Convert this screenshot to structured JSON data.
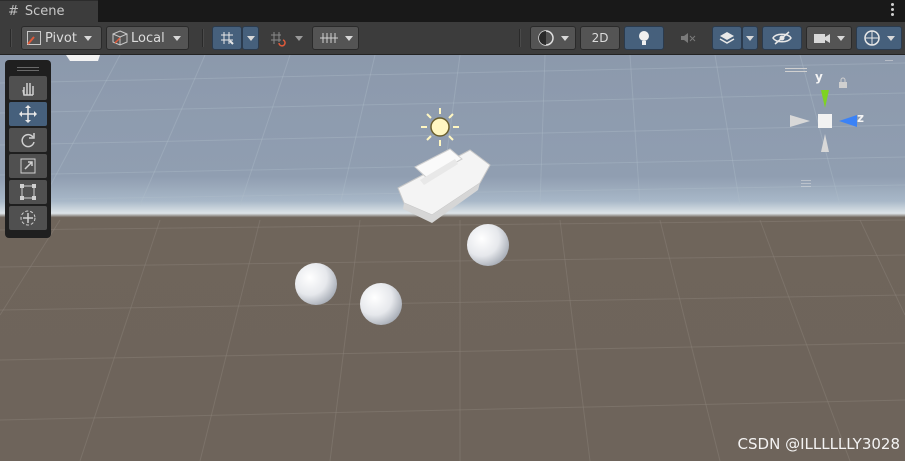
{
  "tab": {
    "icon": "scene-hash-icon",
    "title": "Scene"
  },
  "toolbar": {
    "pivot_label": "Pivot",
    "local_label": "Local",
    "mode_2d_label": "2D"
  },
  "gizmo": {
    "y_label": "y",
    "z_label": "z"
  },
  "watermark": "CSDN @ILLLLLLY3028",
  "colors": {
    "active_button": "#46607c",
    "gizmo_y": "#7ed321",
    "gizmo_z": "#3b82f6",
    "ground": "#6e645b",
    "sky": "#909eb1"
  }
}
